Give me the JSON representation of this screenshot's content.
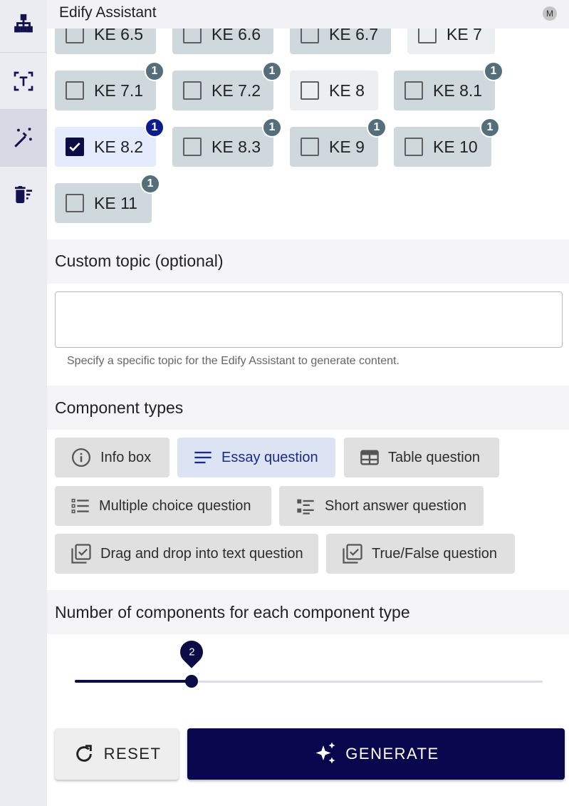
{
  "header": {
    "title": "Edify Assistant",
    "avatar_initial": "M"
  },
  "sidebar": {
    "items": [
      {
        "icon": "sitemap-icon",
        "active": false
      },
      {
        "icon": "text-select-icon",
        "active": false
      },
      {
        "icon": "magic-wand-icon",
        "active": true
      },
      {
        "icon": "delete-sweep-icon",
        "active": false
      }
    ]
  },
  "ke_chips": [
    {
      "label": "KE 6.5",
      "checked": false,
      "badge": null
    },
    {
      "label": "KE 6.6",
      "checked": false,
      "badge": null
    },
    {
      "label": "KE 6.7",
      "checked": false,
      "badge": null
    },
    {
      "label": "KE 7",
      "checked": false,
      "badge": null
    },
    {
      "label": "KE 7.1",
      "checked": false,
      "badge": "1"
    },
    {
      "label": "KE 7.2",
      "checked": false,
      "badge": "1"
    },
    {
      "label": "KE 8",
      "checked": false,
      "badge": null
    },
    {
      "label": "KE 8.1",
      "checked": false,
      "badge": "1"
    },
    {
      "label": "KE 8.2",
      "checked": true,
      "badge": "1"
    },
    {
      "label": "KE 8.3",
      "checked": false,
      "badge": "1"
    },
    {
      "label": "KE 9",
      "checked": false,
      "badge": "1"
    },
    {
      "label": "KE 10",
      "checked": false,
      "badge": "1"
    },
    {
      "label": "KE 11",
      "checked": false,
      "badge": "1"
    }
  ],
  "custom_topic": {
    "title": "Custom topic (optional)",
    "value": "",
    "placeholder": "",
    "helper": "Specify a specific topic for the Edify Assistant to generate content."
  },
  "component_types": {
    "title": "Component types",
    "items": [
      {
        "label": "Info box",
        "icon": "info-icon",
        "selected": false
      },
      {
        "label": "Essay question",
        "icon": "lines-icon",
        "selected": true
      },
      {
        "label": "Table question",
        "icon": "table-icon",
        "selected": false
      },
      {
        "label": "Multiple choice question",
        "icon": "list-icon",
        "selected": false
      },
      {
        "label": "Short answer question",
        "icon": "short-answer-icon",
        "selected": false
      },
      {
        "label": "Drag and drop into text question",
        "icon": "checkbox-multiple-icon",
        "selected": false
      },
      {
        "label": "True/False question",
        "icon": "checkbox-multiple-icon",
        "selected": false
      }
    ]
  },
  "components_count": {
    "title": "Number of components for each component type",
    "value": "2",
    "fraction": 0.25
  },
  "buttons": {
    "reset": "RESET",
    "generate": "GENERATE"
  },
  "colors": {
    "primary": "#08074d",
    "chip": "#cfd8dc",
    "chip_light": "#eceff1",
    "chip_selected": "#e3ebfd",
    "badge": "#546e7a",
    "badge_selected": "#0d1c8c"
  }
}
